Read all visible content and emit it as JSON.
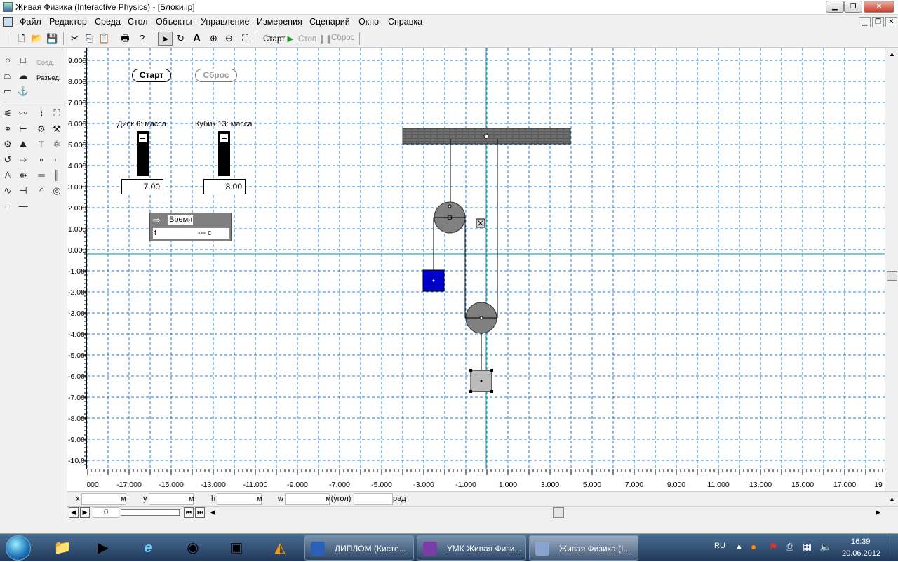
{
  "window": {
    "title": "Живая Физика (Interactive Physics) - [Блоки.ip]"
  },
  "menu": [
    "Файл",
    "Редактор",
    "Среда",
    "Стол",
    "Объекты",
    "Управление",
    "Измерения",
    "Сценарий",
    "Окно",
    "Справка"
  ],
  "toolbar": {
    "start_label": "Старт",
    "stop_label": "Стоп",
    "reset_label": "Сброс"
  },
  "palette": {
    "join_label": "Соед.",
    "split_label": "Разъед."
  },
  "canvas": {
    "start_button": "Старт",
    "reset_button": "Сброс",
    "slider1": {
      "label": "Диск 6: масса",
      "value": "7.00"
    },
    "slider2": {
      "label": "Кубик 13: масса",
      "value": "8.00"
    },
    "meter": {
      "title": "Время",
      "var": "t",
      "value": "--- с"
    }
  },
  "rulers": {
    "y_labels": [
      "9.000",
      "8.000",
      "7.000",
      "6.000",
      "5.000",
      "4.000",
      "3.000",
      "2.000",
      "1.000",
      "0.000",
      "-1.000",
      "-2.000",
      "-3.000",
      "-4.000",
      "-5.000",
      "-6.000",
      "-7.000",
      "-8.000",
      "-9.000",
      "-10.00"
    ],
    "x_labels": [
      "000",
      "-17.000",
      "-15.000",
      "-13.000",
      "-11.000",
      "-9.000",
      "-7.000",
      "-5.000",
      "-3.000",
      "-1.000",
      "1.000",
      "3.000",
      "5.000",
      "7.000",
      "9.000",
      "11.000",
      "13.000",
      "15.000",
      "17.000",
      "19"
    ]
  },
  "coords": {
    "x_label": "x",
    "x_unit": "м",
    "y_label": "y",
    "y_unit": "м",
    "h_label": "h",
    "h_unit": "м",
    "w_label": "w",
    "w_unit": "м(угол)",
    "angle_unit": "рад"
  },
  "frame": {
    "counter": "0"
  },
  "taskbar": {
    "tasks": [
      "ДИПЛОМ (Кисте...",
      "УМК Живая Физи...",
      "Живая Физика (I..."
    ],
    "lang": "RU",
    "time": "16:39",
    "date": "20.06.2012"
  },
  "colors": {
    "grid": "#1f7fd6",
    "axis": "#2aa7b3",
    "blue_block": "#0000cc",
    "body_gray": "#808080"
  }
}
